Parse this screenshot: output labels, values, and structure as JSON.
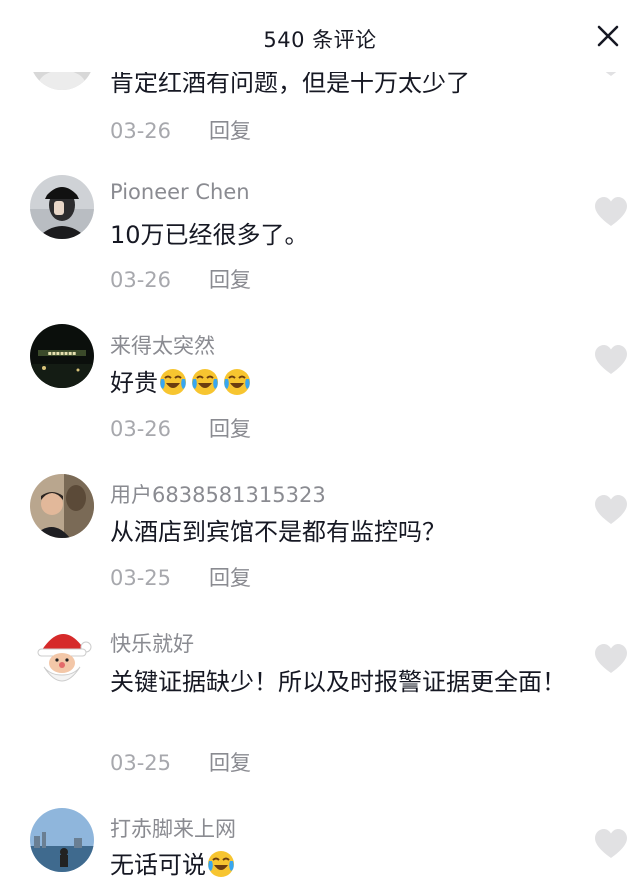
{
  "header": {
    "title": "540 条评论",
    "close_label": "✕"
  },
  "colors": {
    "text": "#161823",
    "secondary": "#8a8b91",
    "like_icon": "#e1e1e3"
  },
  "comments": [
    {
      "author": "",
      "text": "肯定红酒有问题，但是十万太少了",
      "date": "03-26",
      "reply_label": "回复",
      "avatar_icon": "avatar-gray-partial"
    },
    {
      "author": "Pioneer Chen",
      "text": "10万已经很多了。",
      "date": "03-26",
      "reply_label": "回复",
      "avatar_icon": "avatar-black-cap-person"
    },
    {
      "author": "来得太突然",
      "text": "好贵",
      "emoji_count": 3,
      "emoji_icon": "laugh-cry-emoji",
      "date": "03-26",
      "reply_label": "回复",
      "avatar_icon": "avatar-night-city"
    },
    {
      "author": "用户6838581315323",
      "text": "从酒店到宾馆不是都有监控吗？",
      "date": "03-25",
      "reply_label": "回复",
      "avatar_icon": "avatar-man-with-statue"
    },
    {
      "author": "快乐就好",
      "text": "关键证据缺少！所以及时报警证据更全面！",
      "date": "03-25",
      "reply_label": "回复",
      "avatar_icon": "avatar-santa"
    },
    {
      "author": "打赤脚来上网",
      "text": "无话可说",
      "emoji_count": 1,
      "emoji_icon": "laugh-cry-emoji",
      "date": "",
      "reply_label": "",
      "avatar_icon": "avatar-seaside"
    }
  ]
}
